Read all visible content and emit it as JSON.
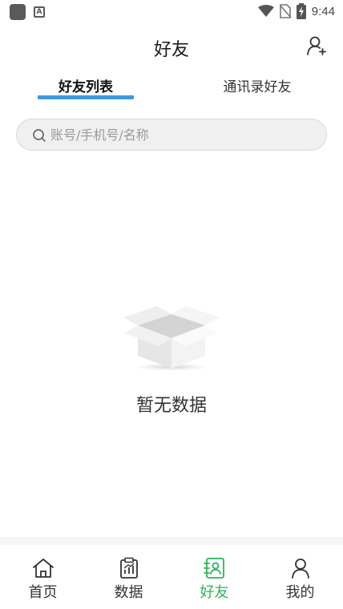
{
  "status_bar": {
    "time": "9:44",
    "app_icon": "square-notification-icon",
    "notif_icon": "a-notification-icon",
    "wifi_icon": "wifi-icon",
    "sim_icon": "no-sim-icon",
    "battery_icon": "battery-charging-icon"
  },
  "header": {
    "title": "好友",
    "action_icon": "add-user-icon"
  },
  "tabs": [
    {
      "label": "好友列表",
      "active": true
    },
    {
      "label": "通讯录好友",
      "active": false
    }
  ],
  "search": {
    "placeholder": "账号/手机号/名称",
    "value": ""
  },
  "empty_state": {
    "icon": "empty-box-icon",
    "text": "暂无数据"
  },
  "bottom_nav": [
    {
      "label": "首页",
      "icon": "home-icon",
      "active": false
    },
    {
      "label": "数据",
      "icon": "data-clipboard-icon",
      "active": false
    },
    {
      "label": "好友",
      "icon": "contacts-book-icon",
      "active": true
    },
    {
      "label": "我的",
      "icon": "user-icon",
      "active": false
    }
  ],
  "colors": {
    "tab_indicator": "#3c9be0",
    "nav_active": "#2cb45a",
    "text_primary": "#1a1a1a"
  }
}
